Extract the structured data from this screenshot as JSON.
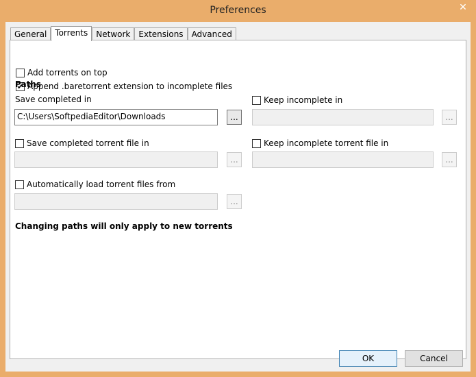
{
  "window": {
    "title": "Preferences",
    "close_symbol": "✕"
  },
  "tabs": [
    "General",
    "Torrents",
    "Network",
    "Extensions",
    "Advanced"
  ],
  "active_tab": "Torrents",
  "options": {
    "add_on_top": {
      "label": "Add torrents on top",
      "checked": false
    },
    "append_ext": {
      "label": "Append .baretorrent extension to incomplete files",
      "checked": true
    }
  },
  "paths": {
    "heading": "Paths",
    "save_completed_label": "Save completed in",
    "save_completed_value": "C:\\Users\\SoftpediaEditor\\Downloads",
    "keep_incomplete_label": "Keep incomplete in",
    "save_torrent_file_label": "Save completed torrent file in",
    "keep_incomplete_torrent_label": "Keep incomplete torrent file in",
    "auto_load_label": "Automatically load torrent files from",
    "browse_label": "...",
    "note": "Changing paths will only apply to new torrents"
  },
  "checks": {
    "unchecked": "",
    "checked": "✔"
  },
  "buttons": {
    "ok": "OK",
    "cancel": "Cancel"
  }
}
